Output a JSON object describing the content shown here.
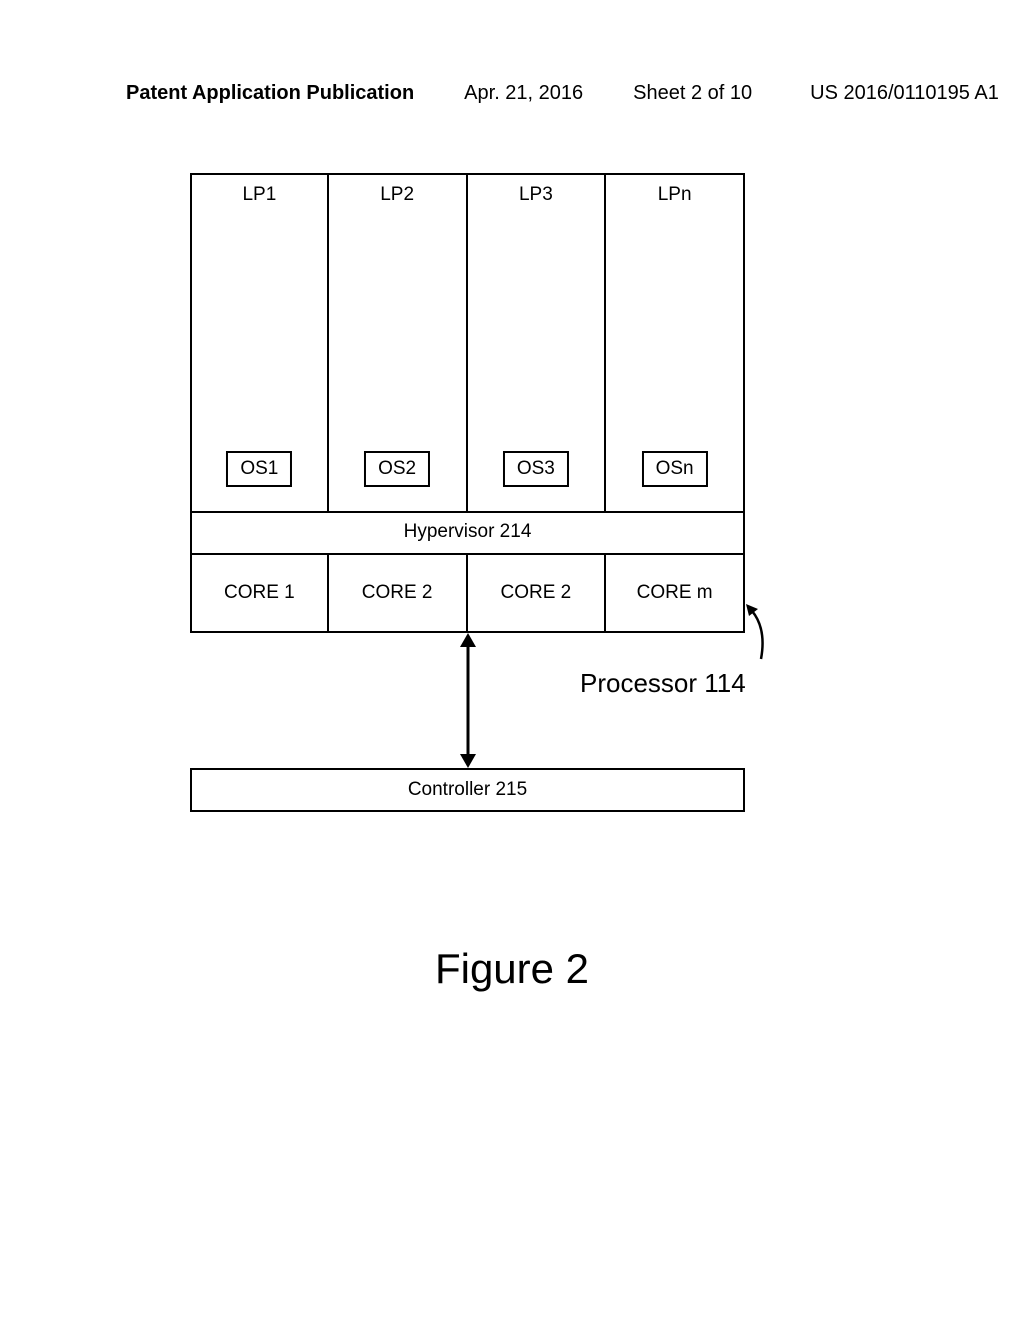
{
  "header": {
    "publication_type": "Patent Application Publication",
    "date": "Apr. 21, 2016",
    "sheet": "Sheet 2 of 10",
    "pub_number": "US 2016/0110195 A1"
  },
  "diagram": {
    "lp": [
      "LP1",
      "LP2",
      "LP3",
      "LPn"
    ],
    "os": [
      "OS1",
      "OS2",
      "OS3",
      "OSn"
    ],
    "hypervisor": "Hypervisor 214",
    "cores": [
      "CORE 1",
      "CORE 2",
      "CORE 2",
      "CORE m"
    ],
    "processor_label": "Processor 114",
    "controller": "Controller 215"
  },
  "figure_caption": "Figure 2"
}
